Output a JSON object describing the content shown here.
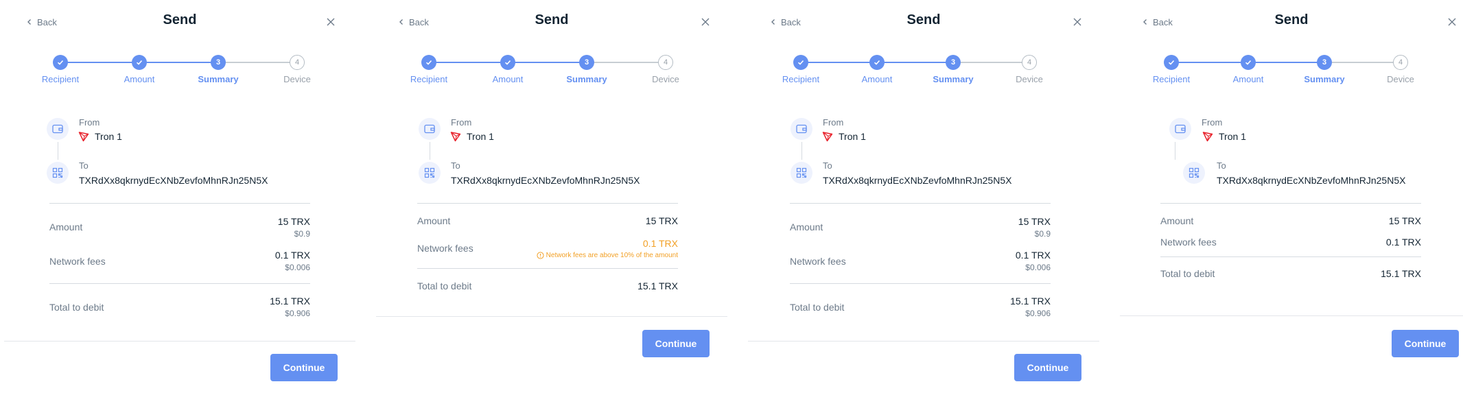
{
  "common": {
    "back_label": "Back",
    "title": "Send",
    "steps": [
      "Recipient",
      "Amount",
      "Summary",
      "Device"
    ],
    "step_numbers": [
      "3",
      "4"
    ],
    "from_label": "From",
    "account_name": "Tron 1",
    "to_label": "To",
    "recipient_address": "TXRdXx8qkrnydEcXNbZevfoMhnRJn25N5X",
    "continue_label": "Continue"
  },
  "labels": {
    "amount": "Amount",
    "network_fees": "Network fees",
    "total": "Total to debit"
  },
  "values": {
    "amount": "15 TRX",
    "amount_fiat": "$0.9",
    "fees": "0.1 TRX",
    "fees_fiat": "$0.006",
    "total": "15.1 TRX",
    "total_fiat": "$0.906",
    "fees_warning": "Network fees are above 10% of the amount"
  },
  "colors": {
    "accent": "#6490f1",
    "warning": "#f2a026",
    "muted_text": "#6c7a89"
  }
}
